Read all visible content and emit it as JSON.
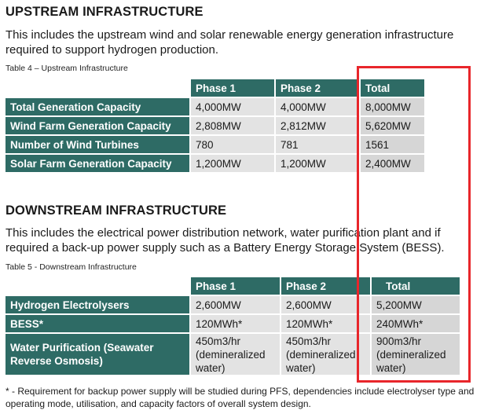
{
  "upstream": {
    "heading": "UPSTREAM INFRASTRUCTURE",
    "paragraph": "This includes the upstream wind and solar renewable energy generation infrastructure required to support hydrogen production.",
    "caption": "Table 4 – Upstream Infrastructure",
    "headers": [
      "Phase 1",
      "Phase 2",
      "Total"
    ],
    "rows": [
      {
        "label": "Total Generation Capacity",
        "values": [
          "4,000MW",
          "4,000MW",
          "8,000MW"
        ]
      },
      {
        "label": "Wind Farm Generation Capacity",
        "values": [
          "2,808MW",
          "2,812MW",
          "5,620MW"
        ]
      },
      {
        "label": "Number of Wind Turbines",
        "values": [
          "780",
          "781",
          "1561"
        ]
      },
      {
        "label": "Solar Farm Generation Capacity",
        "values": [
          "1,200MW",
          "1,200MW",
          "2,400MW"
        ]
      }
    ]
  },
  "downstream": {
    "heading": "DOWNSTREAM INFRASTRUCTURE",
    "paragraph": "This includes the electrical power distribution network, water purification plant and if required a back-up power supply such as a Battery Energy Storage System (BESS).",
    "caption": "Table 5 - Downstream Infrastructure",
    "headers": [
      "Phase 1",
      "Phase 2",
      "Total"
    ],
    "rows": [
      {
        "label": "Hydrogen Electrolysers",
        "values": [
          "2,600MW",
          "2,600MW",
          "5,200MW"
        ]
      },
      {
        "label": "BESS*",
        "values": [
          "120MWh*",
          "120MWh*",
          "240MWh*"
        ]
      },
      {
        "label": "Water Purification (Seawater Reverse Osmosis)",
        "values": [
          "450m3/hr (demineralized water)",
          "450m3/hr (demineralized water)",
          "900m3/hr (demineralized water)"
        ]
      }
    ]
  },
  "footnote": "* - Requirement for backup power supply will be studied during PFS, dependencies include electrolyser type and operating mode, utilisation, and capacity factors of overall system design.",
  "highlight_color": "#e8262b",
  "table_header_color": "#2e6b65"
}
